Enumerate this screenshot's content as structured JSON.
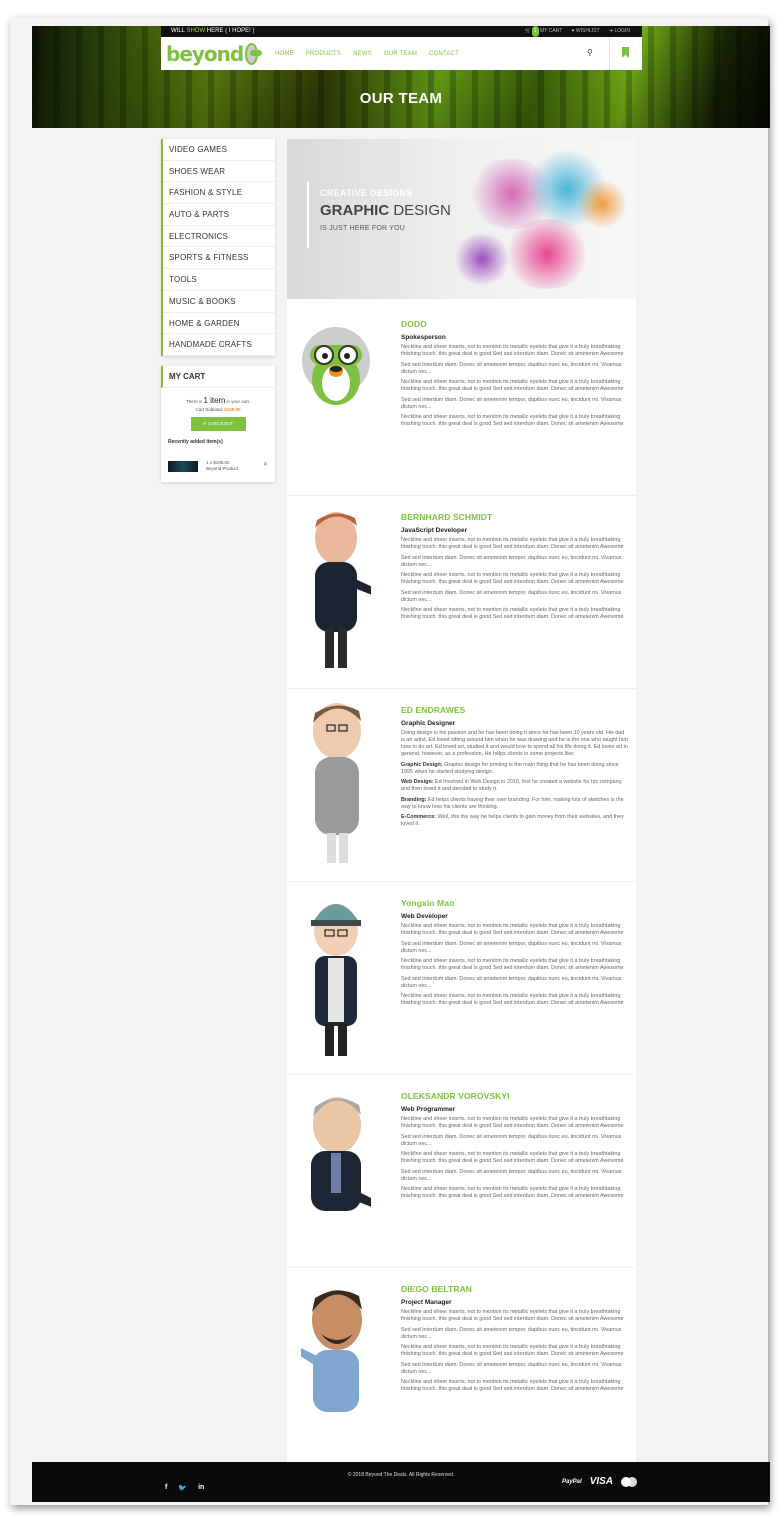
{
  "topbar": {
    "text_left": "WILL",
    "text_mid": "SHOW",
    "text_right": "HERE ( I HOPE! )",
    "cart_count": "1",
    "cart_label": "MY CART",
    "wishlist": "WISHLIST",
    "login": "LOGIN"
  },
  "logo": {
    "text": "beyond"
  },
  "nav": [
    "HOME",
    "PRODUCTS",
    "NEWS",
    "OUR TEAM",
    "CONTACT"
  ],
  "hero": {
    "title": "OUR TEAM"
  },
  "categories": [
    "VIDEO GAMES",
    "SHOES WEAR",
    "FASHION & STYLE",
    "AUTO & PARTS",
    "ELECTRONICS",
    "SPORTS & FITNESS",
    "TOOLS",
    "MUSIC & BOOKS",
    "HOME & GARDEN",
    "HANDMADE CRAFTS"
  ],
  "cart": {
    "title": "MY CART",
    "line_pre": "There is",
    "line_count": "1 item",
    "line_post": "in your cart.",
    "subtotal_label": "Cart Subtotal:",
    "subtotal": "$199.00",
    "checkout": "CHECKOUT",
    "recent_label": "Recently added item(s)",
    "item_qty": "1 x $199.00",
    "item_name": "Beyond Product"
  },
  "banner": {
    "line1": "CREATIVE DESIGNS",
    "line2a": "GRAPHIC",
    "line2b": "DESIGN",
    "line3": "IS JUST HERE FOR YOU"
  },
  "members": [
    {
      "name": "DODO",
      "role": "Spokesperson",
      "paras": [
        "Neckline and sheer inserts, not to mention its metallic eyelets that give it a truly breathtaking finishing touch. this great deal is good Sed sed interdum diam. Donec sit ametenim Awesome",
        "Sed sed interdum diam. Donec sit ametenim tempor, dapibus nunc eu, tincidunt mi. Vivamus dictum nec...",
        "Neckline and sheer inserts, not to mention its metallic eyelets that give it a truly breathtaking finishing touch. this great deal is good Sed sed interdum diam. Donec sit ametenim Awesome",
        "Sed sed interdum diam. Donec sit ametenim tempor, dapibus nunc eu, tincidunt mi. Vivamus dictum nec...",
        "Neckline and sheer inserts, not to mention its metallic eyelets that give it a truly breathtaking finishing touch. this great deal is good Sed sed interdum diam. Donec sit ametenim Awesome"
      ]
    },
    {
      "name": "BERNHARD SCHMIDT",
      "role": "JavaScript Developer",
      "paras": [
        "Neckline and sheer inserts, not to mention its metallic eyelets that give it a truly breathtaking finishing touch. this great deal is good Sed sed interdum diam. Donec sit ametenim Awesome",
        "Sed sed interdum diam. Donec sit ametenim tempor, dapibus nunc eu, tincidunt mi. Vivamus dictum nec...",
        "Neckline and sheer inserts, not to mention its metallic eyelets that give it a truly breathtaking finishing touch. this great deal is good Sed sed interdum diam. Donec sit ametenim Awesome",
        "Sed sed interdum diam. Donec sit ametenim tempor, dapibus nunc eu, tincidunt mi. Vivamus dictum nec...",
        "Neckline and sheer inserts, not to mention its metallic eyelets that give it a truly breathtaking finishing touch. this great deal is good Sed sed interdum diam. Donec sit ametenim Awesome"
      ]
    },
    {
      "name": "ED ENDRAWES",
      "role": "Graphic Designer",
      "intro": "Doing design is his passion and he has been doing it since he has been 10 years old. His dad is an artist, Ed loved sitting around him when he was drawing and he is the one who taught him how to do art. Ed loved art, studied it and would love to spend all his life doing it. Ed loves art in general; however, as a profession, He helps clients in some projects like:",
      "items": [
        {
          "k": "Graphic Design:",
          "v": "Graphic design for printing is the main thing that he has been doing since 1995 when he started studying design."
        },
        {
          "k": "Web Design:",
          "v": "Ed Involved in Web Design in 2010, first he created a website for his company, and then loved it and decided to study it."
        },
        {
          "k": "Branding:",
          "v": "Ed helps clients having their own branding. For him, making lots of sketches is the way to know how his clients are thinking."
        },
        {
          "k": "E-Commerce:",
          "v": "Well, this the way he helps clients to gain money from their websites, and they loved it."
        }
      ]
    },
    {
      "name": "Yongxin Mao",
      "role": "Web Developer",
      "paras": [
        "Neckline and sheer inserts, not to mention its metallic eyelets that give it a truly breathtaking finishing touch. this great deal is good Sed sed interdum diam. Donec sit ametenim Awesome",
        "Sed sed interdum diam. Donec sit ametenim tempor, dapibus nunc eu, tincidunt mi. Vivamus dictum nec...",
        "Neckline and sheer inserts, not to mention its metallic eyelets that give it a truly breathtaking finishing touch. this great deal is good Sed sed interdum diam. Donec sit ametenim Awesome",
        "Sed sed interdum diam. Donec sit ametenim tempor, dapibus nunc eu, tincidunt mi. Vivamus dictum nec...",
        "Neckline and sheer inserts, not to mention its metallic eyelets that give it a truly breathtaking finishing touch. this great deal is good Sed sed interdum diam. Donec sit ametenim Awesome"
      ]
    },
    {
      "name": "OLEKSANDR VOROVSKYI",
      "role": "Web Programmer",
      "paras": [
        "Neckline and sheer inserts, not to mention its metallic eyelets that give it a truly breathtaking finishing touch. this great deal is good Sed sed interdum diam. Donec sit ametenim Awesome",
        "Sed sed interdum diam. Donec sit ametenim tempor, dapibus nunc eu, tincidunt mi. Vivamus dictum nec...",
        "Neckline and sheer inserts, not to mention its metallic eyelets that give it a truly breathtaking finishing touch. this great deal is good Sed sed interdum diam. Donec sit ametenim Awesome",
        "Sed sed interdum diam. Donec sit ametenim tempor, dapibus nunc eu, tincidunt mi. Vivamus dictum nec...",
        "Neckline and sheer inserts, not to mention its metallic eyelets that give it a truly breathtaking finishing touch. this great deal is good Sed sed interdum diam. Donec sit ametenim Awesome"
      ]
    },
    {
      "name": "DIEGO BELTRAN",
      "role": "Project Manager",
      "paras": [
        "Neckline and sheer inserts, not to mention its metallic eyelets that give it a truly breathtaking finishing touch. this great deal is good Sed sed interdum diam. Donec sit ametenim Awesome",
        "Sed sed interdum diam. Donec sit ametenim tempor, dapibus nunc eu, tincidunt mi. Vivamus dictum nec...",
        "Neckline and sheer inserts, not to mention its metallic eyelets that give it a truly breathtaking finishing touch. this great deal is good Sed sed interdum diam. Donec sit ametenim Awesome",
        "Sed sed interdum diam. Donec sit ametenim tempor, dapibus nunc eu, tincidunt mi. Vivamus dictum nec...",
        "Neckline and sheer inserts, not to mention its metallic eyelets that give it a truly breathtaking finishing touch. this great deal is good Sed sed interdum diam. Donec sit ametenim Awesome"
      ]
    }
  ],
  "footer": {
    "copyright": "© 2018 Beyond The Deals. All Rights Reserved.",
    "social": [
      "f",
      "t",
      "in"
    ],
    "payments": [
      "PayPal",
      "VISA"
    ]
  },
  "colors": {
    "accent": "#7ec13e",
    "price": "#e69a1a"
  }
}
